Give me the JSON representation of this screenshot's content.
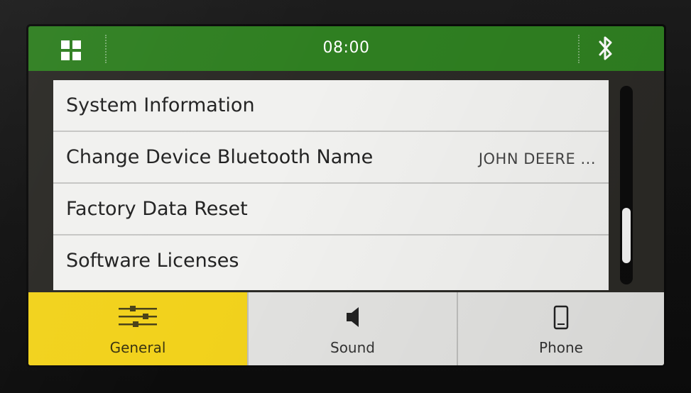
{
  "header": {
    "time": "08:00",
    "apps_icon": "grid-icon",
    "status_icon": "bluetooth-icon"
  },
  "settings": {
    "items": [
      {
        "label": "System Information",
        "value": ""
      },
      {
        "label": "Change Device Bluetooth Name",
        "value": "JOHN DEERE ..."
      },
      {
        "label": "Factory Data Reset",
        "value": ""
      },
      {
        "label": "Software Licenses",
        "value": ""
      }
    ]
  },
  "tabs": [
    {
      "label": "General",
      "icon": "sliders-icon",
      "active": true
    },
    {
      "label": "Sound",
      "icon": "speaker-icon",
      "active": false
    },
    {
      "label": "Phone",
      "icon": "phone-icon",
      "active": false
    }
  ],
  "colors": {
    "header_green": "#2f7f21",
    "active_tab_yellow": "#f2d21c",
    "list_background": "#f1f1ef"
  }
}
